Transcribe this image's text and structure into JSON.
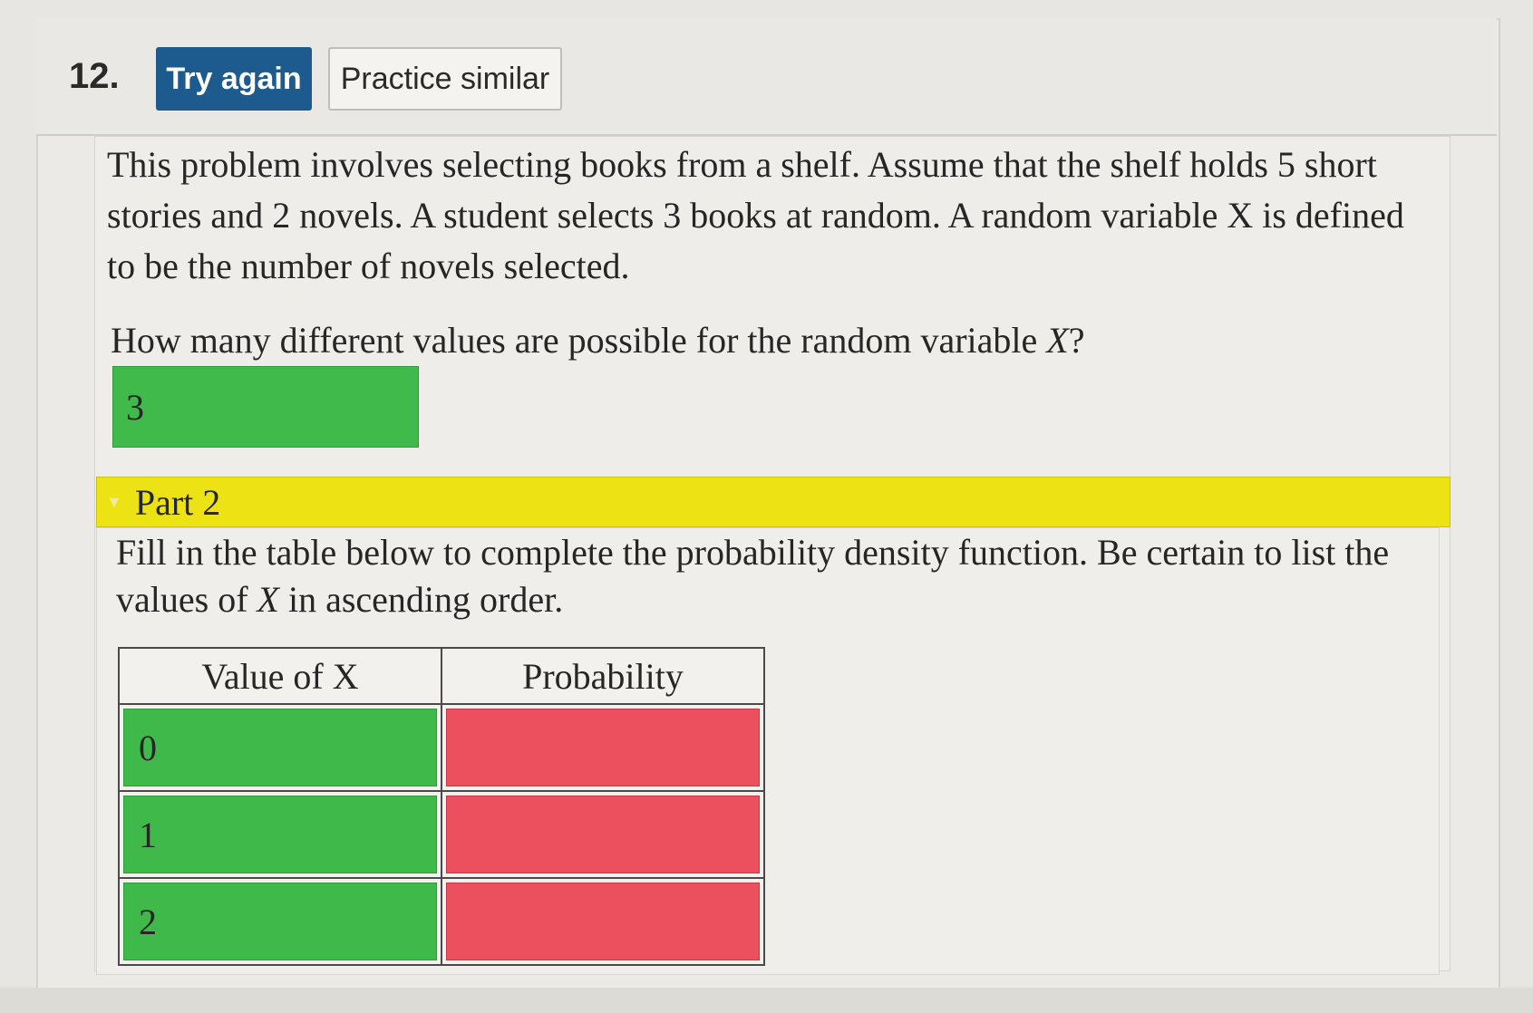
{
  "question": {
    "number": "12.",
    "try_again_label": "Try again",
    "practice_similar_label": "Practice similar"
  },
  "part1": {
    "problem_text": "This problem involves selecting books from a shelf. Assume that the shelf holds 5 short stories and 2 novels. A student selects 3 books at random. A random variable X is defined to be the number of novels selected.",
    "question_prefix": "How many different values are possible for the random variable ",
    "question_var": "X",
    "question_suffix": "?",
    "answer_value": "3",
    "answer_status": "correct"
  },
  "part2": {
    "label": "Part 2",
    "instruction_prefix": "Fill in the table below to complete the probability density function. Be certain to list the values of ",
    "instruction_var": "X",
    "instruction_suffix": " in ascending order.",
    "table": {
      "headers": [
        "Value of X",
        "Probability"
      ],
      "rows": [
        {
          "value": "0",
          "probability": "",
          "value_status": "correct",
          "probability_status": "incorrect"
        },
        {
          "value": "1",
          "probability": "",
          "value_status": "correct",
          "probability_status": "incorrect"
        },
        {
          "value": "2",
          "probability": "",
          "value_status": "correct",
          "probability_status": "incorrect"
        }
      ]
    }
  },
  "colors": {
    "try_again_bg": "#1d5a8e",
    "correct_green": "#3eb94a",
    "incorrect_red": "#ec4f5d",
    "part_bar_yellow": "#ede314"
  }
}
